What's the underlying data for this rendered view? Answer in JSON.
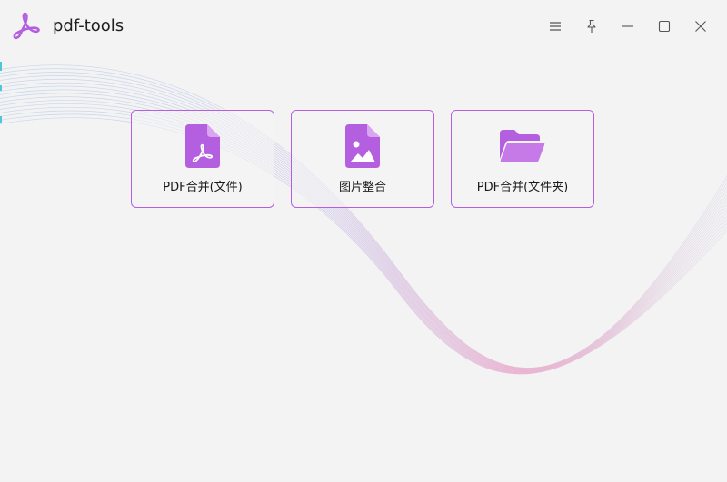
{
  "app": {
    "title": "pdf-tools",
    "accent_color": "#b45fe0",
    "logo_icon": "adobe-pdf-logo-icon"
  },
  "window_controls": [
    {
      "name": "menu",
      "icon": "hamburger-menu-icon"
    },
    {
      "name": "pin",
      "icon": "pin-icon"
    },
    {
      "name": "minimize",
      "icon": "minimize-icon"
    },
    {
      "name": "maximize",
      "icon": "maximize-icon"
    },
    {
      "name": "close",
      "icon": "close-icon"
    }
  ],
  "tools": [
    {
      "label": "PDF合并(文件)",
      "icon": "pdf-file-icon"
    },
    {
      "label": "图片整合",
      "icon": "image-file-icon"
    },
    {
      "label": "PDF合并(文件夹)",
      "icon": "open-folder-icon"
    }
  ],
  "colors": {
    "background": "#f3f3f3",
    "card_border": "#b45fe0",
    "icon_fill": "#b45fe0",
    "wave_blue": "#a9c8e8",
    "wave_pink": "#e8a6c8"
  }
}
